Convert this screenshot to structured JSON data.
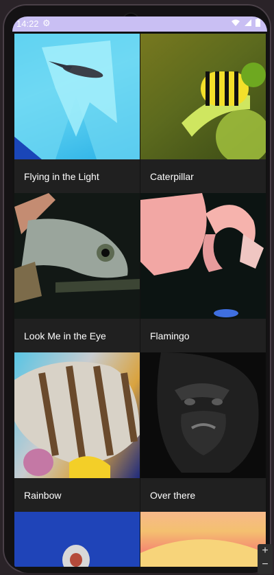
{
  "status": {
    "time": "14:22",
    "icons": [
      "gear-icon",
      "wifi-icon",
      "signal-icon",
      "battery-icon"
    ]
  },
  "gallery": {
    "items": [
      {
        "title": "Flying in the Light",
        "image": "bird-photo"
      },
      {
        "title": "Caterpillar",
        "image": "caterpillar-photo"
      },
      {
        "title": "Look Me in the Eye",
        "image": "chameleon-photo"
      },
      {
        "title": "Flamingo",
        "image": "flamingo-photo"
      },
      {
        "title": "Rainbow",
        "image": "fish-photo"
      },
      {
        "title": "Over there",
        "image": "gorilla-photo"
      }
    ],
    "partial_items": [
      {
        "image": "partial-photo-1"
      },
      {
        "image": "partial-photo-2"
      }
    ]
  },
  "zoom": {
    "in_label": "+",
    "out_label": "−"
  }
}
